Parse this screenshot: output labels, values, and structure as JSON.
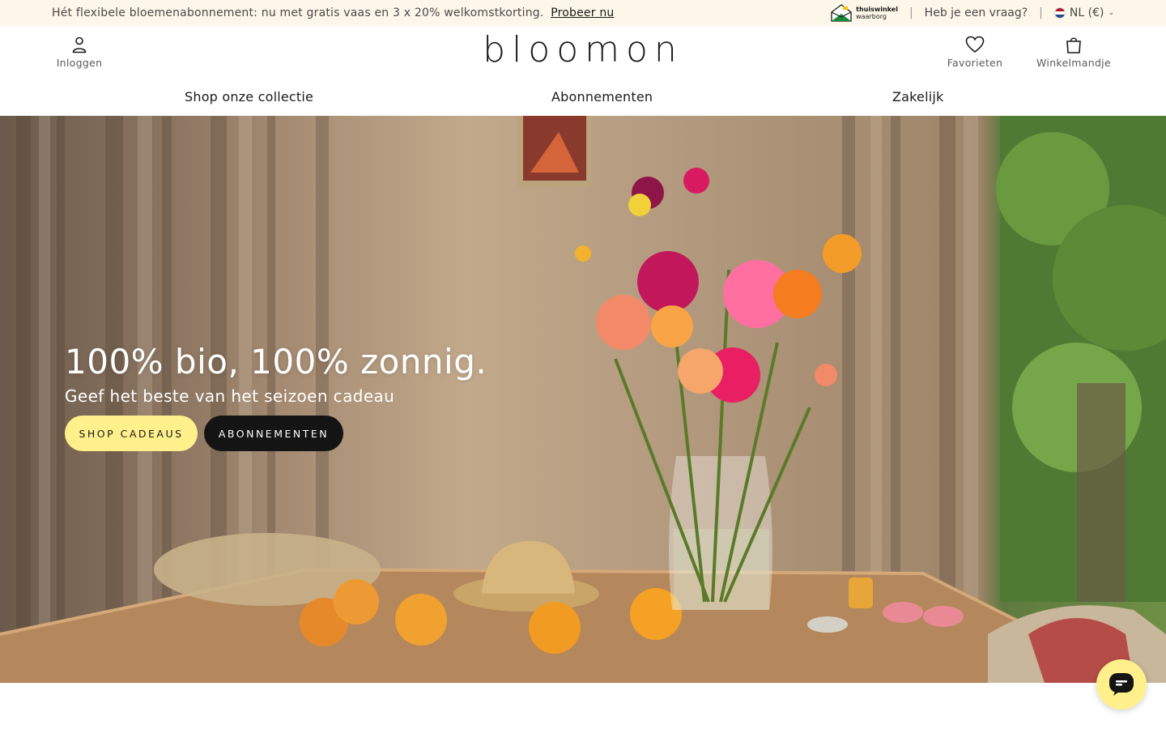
{
  "announcement": {
    "text": "Hét flexibele bloemenabonnement: nu met gratis vaas en 3 x 20% welkomstkorting.",
    "link": "Probeer nu",
    "trust_line1": "thuiswinkel",
    "trust_line2": "waarborg",
    "separator": "|",
    "help": "Heb je een vraag?",
    "language": "NL (€)"
  },
  "header": {
    "login_label": "Inloggen",
    "logo": "bloomon",
    "favorites_label": "Favorieten",
    "cart_label": "Winkelmandje"
  },
  "nav": {
    "items": [
      "Shop onze collectie",
      "Abonnementen",
      "Zakelijk"
    ]
  },
  "hero": {
    "title": "100% bio, 100% zonnig.",
    "subtitle": "Geef het beste van het seizoen cadeau",
    "primary_button": "SHOP CADEAUS",
    "secondary_button": "ABONNEMENTEN"
  },
  "colors": {
    "announcement_bg": "#fdf7e9",
    "accent_yellow": "#fff08c",
    "dark_button": "#141414"
  },
  "icons": {
    "login": "user-icon",
    "favorites": "heart-icon",
    "cart": "shopping-bag-icon",
    "chat": "chat-icon",
    "language": "flag-nl-icon",
    "trust": "thuiswinkel-logo-icon"
  }
}
